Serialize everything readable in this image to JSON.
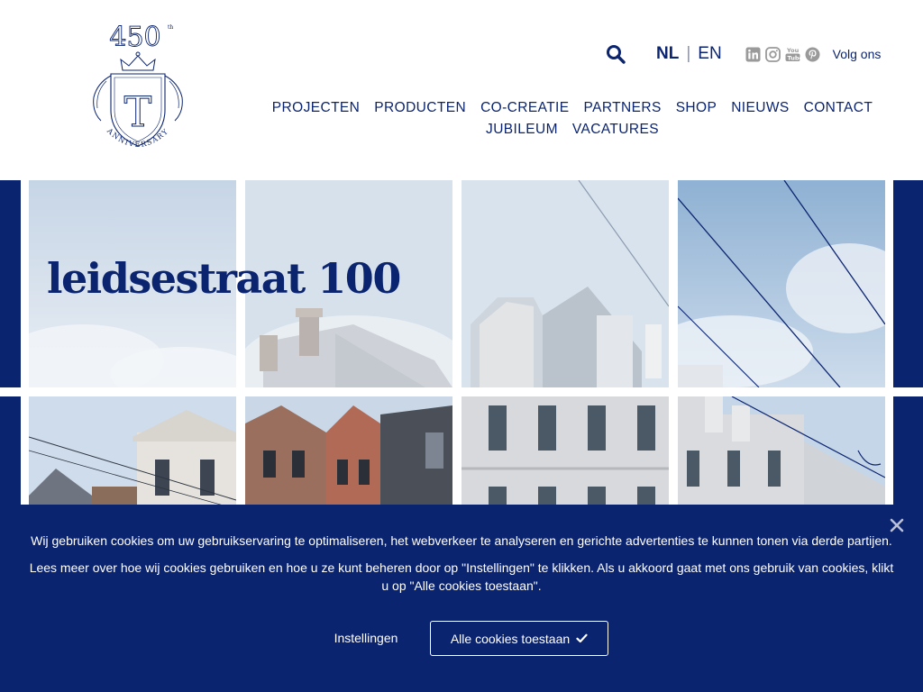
{
  "logo": {
    "number": "450",
    "superscript": "th",
    "letter": "T",
    "ring_text": "ANNIVERSARY"
  },
  "header": {
    "lang_nl": "NL",
    "lang_separator": "|",
    "lang_en": "EN",
    "follow_label": "Volg ons",
    "social_icons": [
      "linkedin-icon",
      "instagram-icon",
      "youtube-icon",
      "pinterest-icon"
    ]
  },
  "nav": {
    "row1": [
      "PROJECTEN",
      "PRODUCTEN",
      "CO-CREATIE",
      "PARTNERS",
      "SHOP",
      "NIEUWS",
      "CONTACT"
    ],
    "row2": [
      "JUBILEUM",
      "VACATURES"
    ]
  },
  "hero": {
    "title": "leidsestraat 100"
  },
  "cookie": {
    "line1": "Wij gebruiken cookies om uw gebruikservaring te optimaliseren, het webverkeer te analyseren en gerichte advertenties te kunnen tonen via derde partijen.",
    "line2": "Lees meer over hoe wij cookies gebruiken en hoe u ze kunt beheren door op \"Instellingen\" te klikken. Als u akkoord gaat met ons gebruik van cookies, klikt u op \"Alle cookies toestaan\".",
    "settings_label": "Instellingen",
    "accept_label": "Alle cookies toestaan"
  },
  "colors": {
    "brand_navy": "#0b2470",
    "social_grey": "#9a9a9a",
    "white": "#ffffff"
  }
}
